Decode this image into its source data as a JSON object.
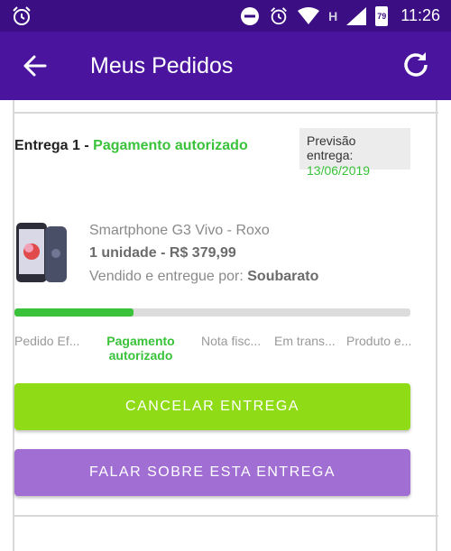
{
  "statusbar": {
    "time": "11:26",
    "battery": "79",
    "network": "H"
  },
  "appbar": {
    "title": "Meus Pedidos"
  },
  "order": {
    "entrega_label": "Entrega 1 - ",
    "entrega_status": "Pagamento autorizado",
    "previsao_label": "Previsão entrega:",
    "previsao_date": "13/06/2019",
    "product_name": "Smartphone G3 Vivo - Roxo",
    "product_qty_price": "1 unidade - R$ 379,99",
    "seller_label": "Vendido e entregue por: ",
    "seller_name": "Soubarato",
    "progress": 0.3,
    "steps": [
      {
        "label": "Pedido Ef..."
      },
      {
        "label": "Pagamento autorizado"
      },
      {
        "label": "Nota fisc..."
      },
      {
        "label": "Em trans..."
      },
      {
        "label": "Produto e..."
      }
    ]
  },
  "buttons": {
    "cancel": "CANCELAR ENTREGA",
    "talk": "FALAR SOBRE ESTA ENTREGA"
  },
  "colors": {
    "appbar": "#4a149f",
    "statusbar": "#3b0f83",
    "green": "#39c23a",
    "cancel_button": "#8fdc16",
    "talk_button": "#a16ed3"
  }
}
